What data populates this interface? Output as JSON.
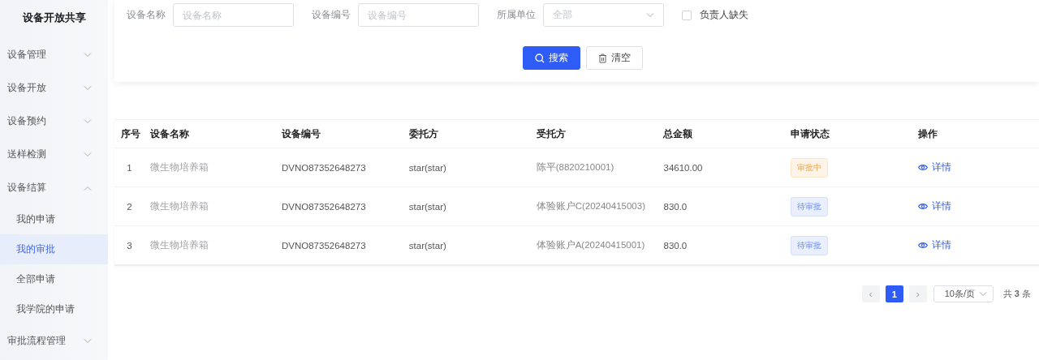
{
  "sidebar": {
    "title": "设备开放共享",
    "items": [
      {
        "label": "设备管理",
        "expanded": false
      },
      {
        "label": "设备开放",
        "expanded": false
      },
      {
        "label": "设备预约",
        "expanded": false
      },
      {
        "label": "送样检测",
        "expanded": false
      },
      {
        "label": "设备结算",
        "expanded": true,
        "children": [
          {
            "label": "我的申请",
            "selected": false
          },
          {
            "label": "我的审批",
            "selected": true
          },
          {
            "label": "全部申请",
            "selected": false
          },
          {
            "label": "我学院的申请",
            "selected": false
          }
        ]
      },
      {
        "label": "审批流程管理",
        "expanded": false
      }
    ]
  },
  "search_form": {
    "fields": [
      {
        "kind": "input",
        "label": "设备名称",
        "placeholder": "设备名称"
      },
      {
        "kind": "input",
        "label": "设备编号",
        "placeholder": "设备编号"
      },
      {
        "kind": "select",
        "label": "所属单位",
        "placeholder": "全部"
      },
      {
        "kind": "checkbox",
        "label": "负责人缺失",
        "checked": false
      }
    ],
    "buttons": [
      {
        "kind": "primary",
        "label": "搜索"
      },
      {
        "kind": "clear",
        "label": "清空"
      }
    ]
  },
  "table": {
    "columns": [
      "序号",
      "设备名称",
      "设备编号",
      "委托方",
      "受托方",
      "总金额",
      "申请状态",
      "操作"
    ],
    "rows": [
      {
        "index": "1",
        "name": "微生物培养箱",
        "code": "DVNO87352648273",
        "client": "star(star)",
        "trustee": "陈平(8820210001)",
        "amount": "34610.00",
        "status": {
          "kind": "reviewing",
          "label": "审批中"
        },
        "action": "详情"
      },
      {
        "index": "2",
        "name": "微生物培养箱",
        "code": "DVNO87352648273",
        "client": "star(star)",
        "trustee": "体验账户C(20240415003)",
        "amount": "830.0",
        "status": {
          "kind": "pending",
          "label": "待审批"
        },
        "action": "详情"
      },
      {
        "index": "3",
        "name": "微生物培养箱",
        "code": "DVNO87352648273",
        "client": "star(star)",
        "trustee": "体验账户A(20240415001)",
        "amount": "830.0",
        "status": {
          "kind": "pending",
          "label": "待审批"
        },
        "action": "详情"
      }
    ]
  },
  "pagination": {
    "prev": "‹",
    "pages": [
      {
        "label": "1",
        "selected": true
      }
    ],
    "next": "›",
    "page_size": "10条/页",
    "total": "共 **3** 条"
  }
}
